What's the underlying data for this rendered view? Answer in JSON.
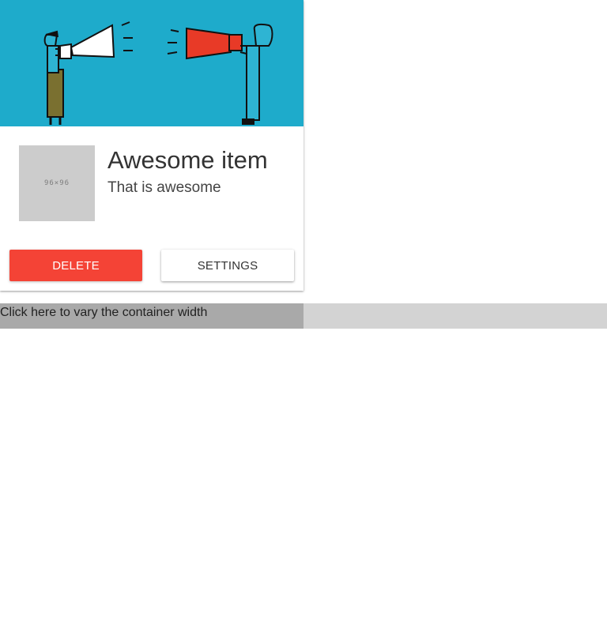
{
  "card": {
    "hero_image": "megaphone-illustration",
    "thumbnail_text": "96×96",
    "title": "Awesome item",
    "subtitle": "That is awesome",
    "actions": {
      "delete_label": "DELETE",
      "settings_label": "SETTINGS"
    }
  },
  "width_control": {
    "label": "Click here to vary the container width",
    "fill_fraction": 0.5
  },
  "colors": {
    "hero_background": "#1eabcb",
    "delete_button": "#f44336",
    "track": "#d3d3d3",
    "fill": "#a9a9a9"
  }
}
